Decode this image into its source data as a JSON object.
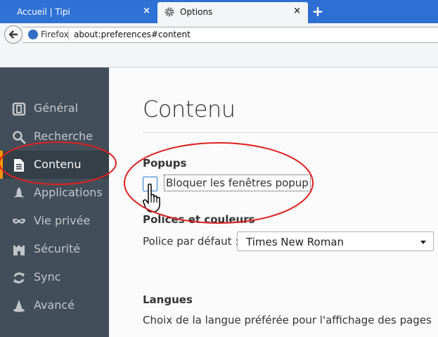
{
  "tabs": [
    {
      "label": "Accueil | Tipi",
      "close": "×",
      "active": false,
      "icon": "none"
    },
    {
      "label": "Options",
      "close": "×",
      "active": true,
      "icon": "gear-icon"
    }
  ],
  "new_tab": "+",
  "navbar": {
    "identity_label": "Firefox",
    "url": "about:preferences#content"
  },
  "sidebar": {
    "items": [
      {
        "label": "Général",
        "icon": "general-icon",
        "selected": false
      },
      {
        "label": "Recherche",
        "icon": "search-icon",
        "selected": false
      },
      {
        "label": "Contenu",
        "icon": "document-icon",
        "selected": true
      },
      {
        "label": "Applications",
        "icon": "rocket-icon",
        "selected": false
      },
      {
        "label": "Vie privée",
        "icon": "mask-icon",
        "selected": false
      },
      {
        "label": "Sécurité",
        "icon": "castle-icon",
        "selected": false
      },
      {
        "label": "Sync",
        "icon": "sync-icon",
        "selected": false
      },
      {
        "label": "Avancé",
        "icon": "wizard-hat-icon",
        "selected": false
      }
    ]
  },
  "main": {
    "title": "Contenu",
    "popups": {
      "heading": "Popups",
      "checkbox_label": "Bloquer les fenêtres popup",
      "checked": false
    },
    "fonts": {
      "heading": "Polices et couleurs",
      "default_font_label": "Police par défaut :",
      "default_font_value": "Times New Roman"
    },
    "languages": {
      "heading": "Langues",
      "description": "Choix de la langue préférée pour l'affichage des pages"
    }
  },
  "colors": {
    "tabstrip": "#2d6fd3",
    "sidebar": "#424f5a",
    "sidebar_selected": "#343f48",
    "selected_accent": "#ff9500",
    "annotation": "#e02020"
  }
}
